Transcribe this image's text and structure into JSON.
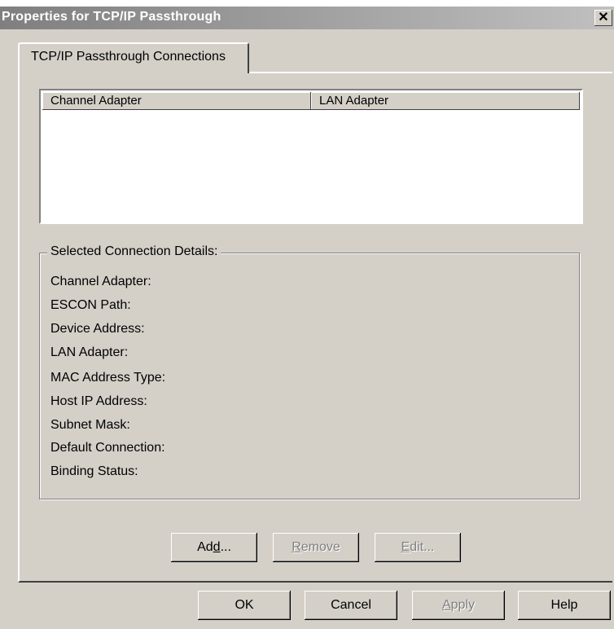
{
  "window": {
    "title": "Properties for TCP/IP Passthrough",
    "close_label": "✕"
  },
  "tab": {
    "label": "TCP/IP Passthrough Connections"
  },
  "list": {
    "columns": [
      "Channel Adapter",
      "LAN Adapter"
    ],
    "rows": []
  },
  "details": {
    "legend": "Selected Connection Details:",
    "labels": [
      "Channel Adapter:",
      "ESCON Path:",
      "Device Address:",
      "LAN Adapter:",
      "MAC Address Type:",
      "Host IP Address:",
      "Subnet Mask:",
      "Default Connection:",
      "Binding Status:"
    ]
  },
  "panel_buttons": {
    "add": {
      "pre": "Ad",
      "mnemonic": "d",
      "post": "...",
      "enabled": true
    },
    "remove": {
      "pre": "",
      "mnemonic": "R",
      "post": "emove",
      "enabled": false
    },
    "edit": {
      "pre": "",
      "mnemonic": "E",
      "post": "dit...",
      "enabled": false
    }
  },
  "dialog_buttons": {
    "ok": "OK",
    "cancel": "Cancel",
    "apply": {
      "pre": "",
      "mnemonic": "A",
      "post": "pply",
      "enabled": false
    },
    "help": "Help"
  },
  "colors": {
    "face": "#d4d0c8",
    "title_gradient_start": "#7f7f7f",
    "title_gradient_end": "#c0c0c0",
    "disabled_text": "#808080"
  }
}
